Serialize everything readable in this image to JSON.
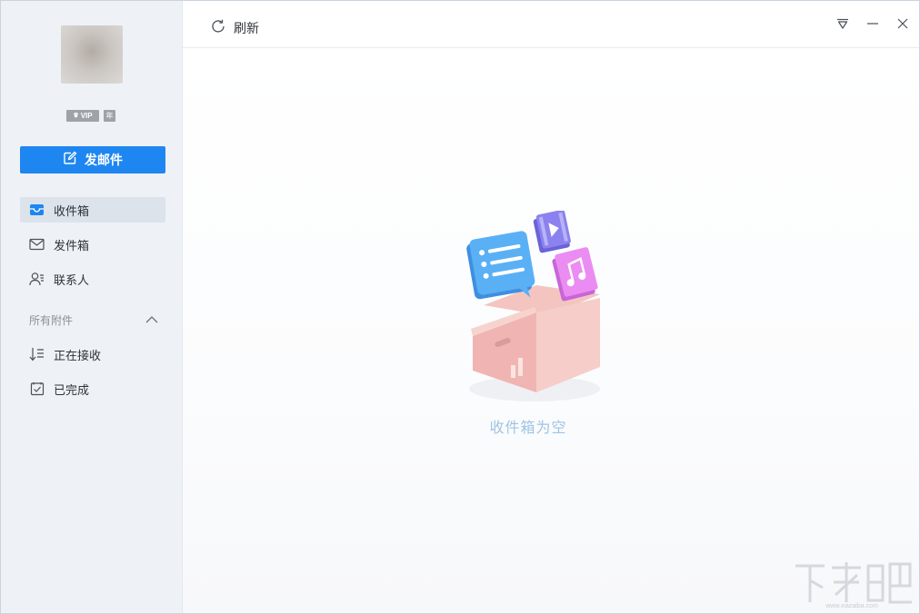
{
  "user": {
    "vip_label": "VIP",
    "year_badge": "年"
  },
  "sidebar": {
    "compose_label": "发邮件",
    "items": [
      {
        "label": "收件箱",
        "icon": "inbox-icon",
        "active": true
      },
      {
        "label": "发件箱",
        "icon": "envelope-icon",
        "active": false
      },
      {
        "label": "联系人",
        "icon": "contacts-icon",
        "active": false
      }
    ],
    "attachments_header": "所有附件",
    "attachment_items": [
      {
        "label": "正在接收",
        "icon": "receiving-icon"
      },
      {
        "label": "已完成",
        "icon": "checkbox-icon"
      }
    ]
  },
  "toolbar": {
    "refresh_label": "刷新"
  },
  "empty_state": {
    "message": "收件箱为空"
  },
  "colors": {
    "accent": "#1e86f0",
    "sidebar_bg": "#eef2f6",
    "empty_text": "#9fc4e4"
  }
}
